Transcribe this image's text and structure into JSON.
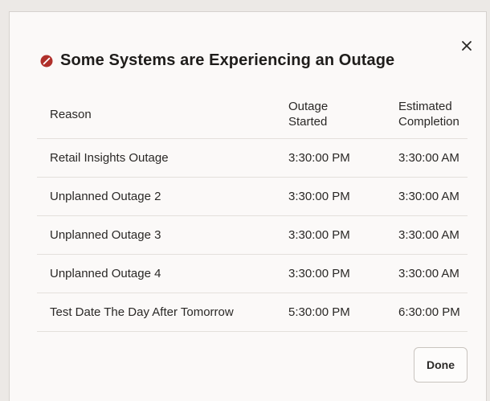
{
  "dialog": {
    "title": "Some Systems are Experiencing an Outage",
    "status_color": "#b0302b",
    "close_icon": "close-icon",
    "error_icon": "error-circle-icon",
    "done_label": "Done"
  },
  "table": {
    "headers": {
      "reason": "Reason",
      "started_line1": "Outage",
      "started_line2": "Started",
      "completion_line1": "Estimated",
      "completion_line2": "Completion"
    },
    "rows": [
      {
        "reason": "Retail Insights Outage",
        "started": "3:30:00 PM",
        "completion": "3:30:00 AM"
      },
      {
        "reason": "Unplanned Outage 2",
        "started": "3:30:00 PM",
        "completion": "3:30:00 AM"
      },
      {
        "reason": "Unplanned Outage 3",
        "started": "3:30:00 PM",
        "completion": "3:30:00 AM"
      },
      {
        "reason": "Unplanned Outage 4",
        "started": "3:30:00 PM",
        "completion": "3:30:00 AM"
      },
      {
        "reason": "Test Date The Day After Tomorrow",
        "started": "5:30:00 PM",
        "completion": "6:30:00 PM"
      }
    ]
  }
}
